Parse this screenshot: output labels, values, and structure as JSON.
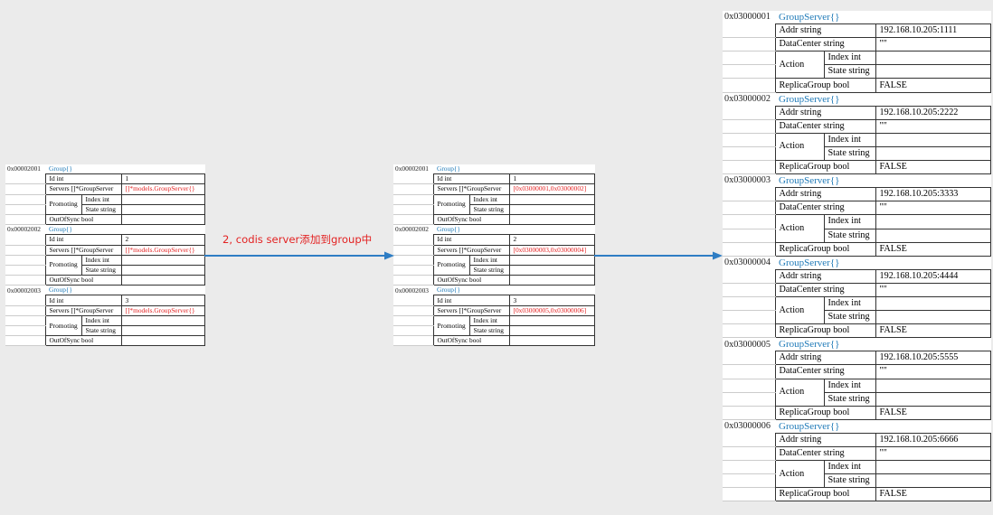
{
  "arrow_label": "2, codis server添加到group中",
  "left_groups": [
    {
      "addr": "0x00002001",
      "type": "Group{}",
      "id_value": "1",
      "servers_value": "[]*models.GroupServer{}"
    },
    {
      "addr": "0x00002002",
      "type": "Group{}",
      "id_value": "2",
      "servers_value": "[]*models.GroupServer{}"
    },
    {
      "addr": "0x00002003",
      "type": "Group{}",
      "id_value": "3",
      "servers_value": "[]*models.GroupServer{}"
    }
  ],
  "mid_groups": [
    {
      "addr": "0x00002001",
      "type": "Group{}",
      "id_value": "1",
      "servers_value": "[0x03000001,0x03000002]"
    },
    {
      "addr": "0x00002002",
      "type": "Group{}",
      "id_value": "2",
      "servers_value": "[0x03000003,0x03000004]"
    },
    {
      "addr": "0x00002003",
      "type": "Group{}",
      "id_value": "3",
      "servers_value": "[0x03000005,0x03000006]"
    }
  ],
  "group_fields": {
    "id": "Id      int",
    "servers": "Servers []*GroupServer",
    "promoting": "Promoting",
    "index": "Index int",
    "state": "State string",
    "outofsync": "OutOfSync bool"
  },
  "server_fields": {
    "addr": "Addr string",
    "datacenter": "DataCenter string",
    "action": "Action",
    "index": "Index int",
    "state": "State string",
    "replica": "ReplicaGroup bool"
  },
  "servers": [
    {
      "addr": "0x03000001",
      "type": "GroupServer{}",
      "addr_value": "192.168.10.205:1111",
      "dc_value": "\"\"",
      "replica_value": "FALSE"
    },
    {
      "addr": "0x03000002",
      "type": "GroupServer{}",
      "addr_value": "192.168.10.205:2222",
      "dc_value": "\"\"",
      "replica_value": "FALSE"
    },
    {
      "addr": "0x03000003",
      "type": "GroupServer{}",
      "addr_value": "192.168.10.205:3333",
      "dc_value": "\"\"",
      "replica_value": "FALSE"
    },
    {
      "addr": "0x03000004",
      "type": "GroupServer{}",
      "addr_value": "192.168.10.205:4444",
      "dc_value": "\"\"",
      "replica_value": "FALSE"
    },
    {
      "addr": "0x03000005",
      "type": "GroupServer{}",
      "addr_value": "192.168.10.205:5555",
      "dc_value": "\"\"",
      "replica_value": "FALSE"
    },
    {
      "addr": "0x03000006",
      "type": "GroupServer{}",
      "addr_value": "192.168.10.205:6666",
      "dc_value": "\"\"",
      "replica_value": "FALSE"
    }
  ],
  "colors": {
    "type_blue": "#1f7ab8",
    "value_red": "#e32222",
    "arrow": "#2e7dc4"
  }
}
